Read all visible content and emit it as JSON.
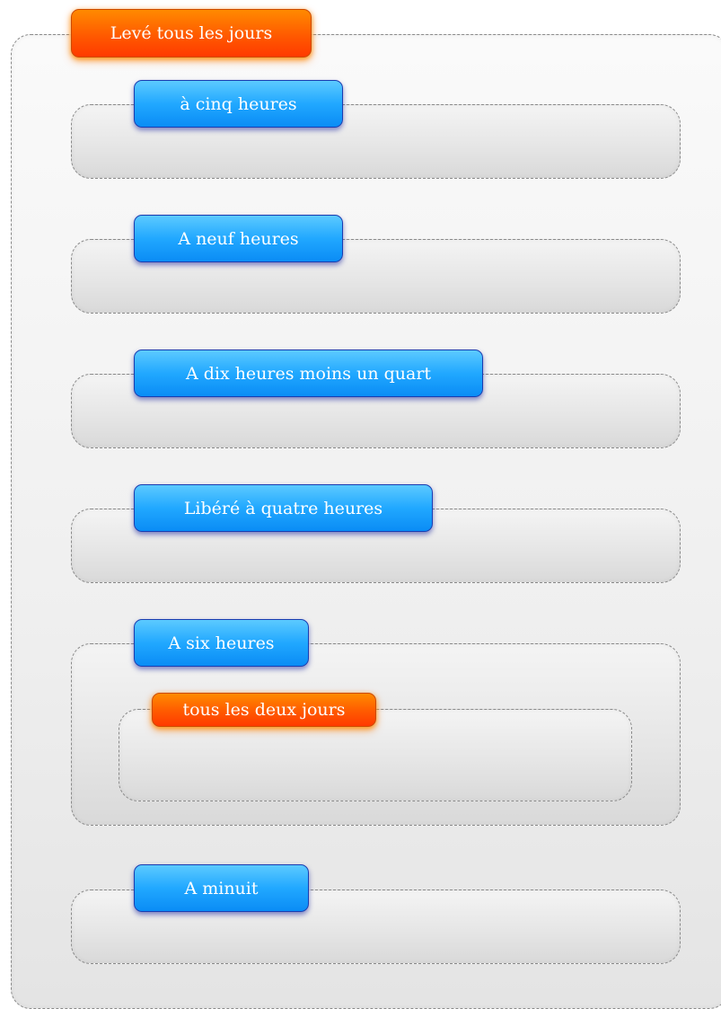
{
  "diagram": {
    "outer": {
      "title": "Levé tous les jours"
    },
    "groups": [
      {
        "title": "à cinq heures"
      },
      {
        "title": "A neuf heures"
      },
      {
        "title": "A dix heures moins un quart"
      },
      {
        "title": "Libéré à quatre heures"
      },
      {
        "title": "A six heures",
        "inner": {
          "title": "tous les deux  jours"
        }
      },
      {
        "title": "A minuit"
      }
    ]
  },
  "colors": {
    "orange_label": "#ff5a00",
    "blue_label": "#21a8ff",
    "frame_border": "#8a8a8a"
  }
}
